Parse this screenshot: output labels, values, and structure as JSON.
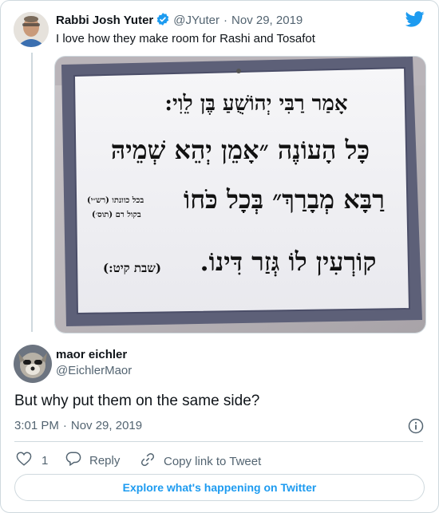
{
  "parent_tweet": {
    "author_name": "Rabbi Josh Yuter",
    "handle": "@JYuter",
    "separator": "·",
    "date": "Nov 29, 2019",
    "text": "I love how they make room for Rashi and Tosafot",
    "image": {
      "line1": "אָמַר רַבִּי יְהוֹשֻׁעַ בֶּן לֵוִי:",
      "line2": "כָּל הָעוֹנֶה ״אָמֵן יְהֵא שְׁמֵיהּ",
      "line3": "רַבָּא מְבָרַךְ״ בְּכָל כֹּחוֹ",
      "line4": "קוֹרְעִין לוֹ גְּזַר דִּינוֹ.",
      "note_rashi": "בכל כוונתו (רש״י)",
      "note_tosafot": "בקול רם (תוס׳)",
      "citation": "(שבת קיט:)"
    }
  },
  "reply_tweet": {
    "author_name": "maor eichler",
    "handle": "@EichlerMaor",
    "text": "But why put them on the same side?",
    "time": "3:01 PM",
    "separator": "·",
    "date": "Nov 29, 2019"
  },
  "actions": {
    "like_count": "1",
    "reply_label": "Reply",
    "copy_link_label": "Copy link to Tweet"
  },
  "explore_label": "Explore what's happening on Twitter",
  "colors": {
    "accent": "#1d9bf0",
    "muted": "#536471",
    "border": "#cfd9de"
  },
  "icons": [
    "twitter-bird-icon",
    "verified-badge-icon",
    "info-icon",
    "heart-icon",
    "reply-bubble-icon",
    "link-icon"
  ]
}
